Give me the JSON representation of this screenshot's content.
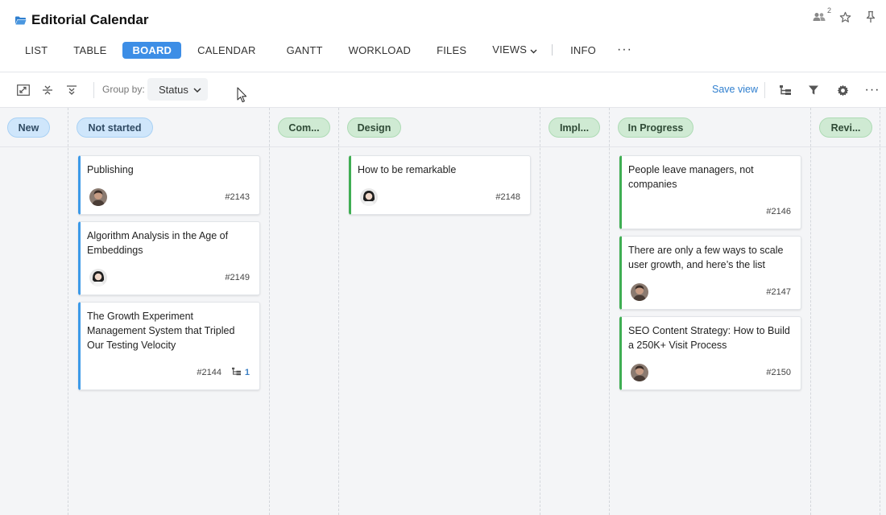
{
  "header": {
    "title": "Editorial Calendar",
    "members_count": "2",
    "icons": [
      "folder-icon",
      "members-icon",
      "star-icon",
      "pin-icon"
    ]
  },
  "tabs": [
    {
      "label": "LIST",
      "active": false
    },
    {
      "label": "TABLE",
      "active": false
    },
    {
      "label": "BOARD",
      "active": true
    },
    {
      "label": "CALENDAR",
      "active": false
    },
    {
      "label": "GANTT",
      "active": false
    },
    {
      "label": "WORKLOAD",
      "active": false
    },
    {
      "label": "FILES",
      "active": false
    },
    {
      "label": "VIEWS",
      "active": false
    },
    {
      "label": "INFO",
      "active": false
    }
  ],
  "more_label": "···",
  "toolbar": {
    "group_by_label": "Group by:",
    "group_by_value": "Status",
    "save_view_label": "Save view",
    "more_label": "···",
    "icons": [
      "expand-icon",
      "collapse-icon",
      "collapse-all-icon",
      "subtasks-icon",
      "filter-icon",
      "gear-icon"
    ]
  },
  "columns": [
    {
      "label": "New",
      "color": "blue"
    },
    {
      "label": "Not started",
      "color": "blue"
    },
    {
      "label": "Com...",
      "color": "green"
    },
    {
      "label": "Design",
      "color": "green"
    },
    {
      "label": "Impl...",
      "color": "green"
    },
    {
      "label": "In Progress",
      "color": "green"
    },
    {
      "label": "Revi...",
      "color": "green"
    }
  ],
  "cards": {
    "not_started": [
      {
        "title": "Publishing",
        "id": "#2143",
        "avatar": "man"
      },
      {
        "title": "Algorithm Analysis in the Age of Embeddings",
        "id": "#2149",
        "avatar": "woman"
      },
      {
        "title": "The Growth Experiment Management System that Tripled Our Testing Velocity",
        "id": "#2144",
        "subtasks": "1"
      }
    ],
    "design": [
      {
        "title": "How to be remarkable",
        "id": "#2148",
        "avatar": "woman"
      }
    ],
    "in_progress": [
      {
        "title": "People leave managers, not companies",
        "id": "#2146"
      },
      {
        "title": "There are only a few ways to scale user growth, and here’s the list",
        "id": "#2147",
        "avatar": "man"
      },
      {
        "title": "SEO Content Strategy: How to Build a 250K+ Visit Process",
        "id": "#2150",
        "avatar": "man"
      }
    ]
  },
  "colors": {
    "accent": "#3d8ee6",
    "blue_edge": "#3d9ae8",
    "green_edge": "#3fae53",
    "link": "#2f7fcf"
  }
}
